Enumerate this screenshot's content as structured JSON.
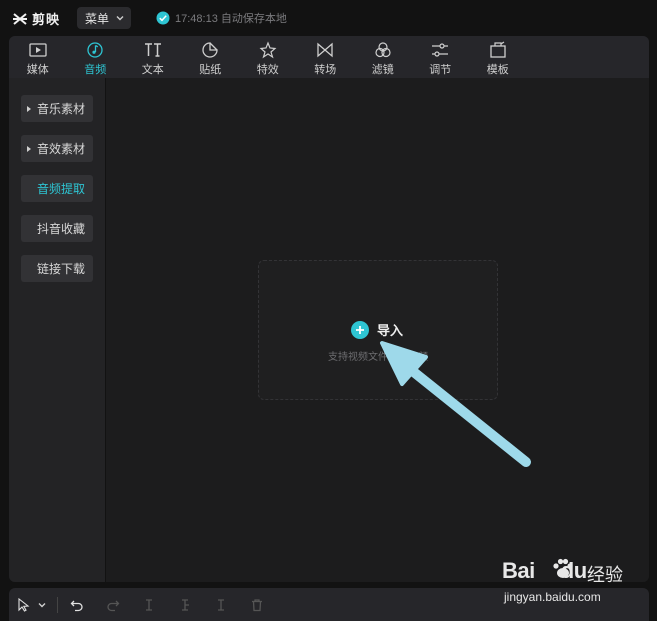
{
  "app": {
    "name": "剪映",
    "menu_label": "菜单",
    "save_status": "17:48:13 自动保存本地"
  },
  "toolbar": {
    "tabs": [
      {
        "label": "媒体",
        "icon": "play-icon"
      },
      {
        "label": "音频",
        "icon": "music-note-icon",
        "active": true
      },
      {
        "label": "文本",
        "icon": "text-icon"
      },
      {
        "label": "贴纸",
        "icon": "sticker-icon"
      },
      {
        "label": "特效",
        "icon": "effects-star-icon"
      },
      {
        "label": "转场",
        "icon": "transition-icon"
      },
      {
        "label": "滤镜",
        "icon": "filter-icon"
      },
      {
        "label": "调节",
        "icon": "adjust-sliders-icon"
      },
      {
        "label": "模板",
        "icon": "template-icon"
      }
    ]
  },
  "sidebar": {
    "items": [
      {
        "label": "音乐素材",
        "expandable": true
      },
      {
        "label": "音效素材",
        "expandable": true
      },
      {
        "label": "音频提取",
        "active": true
      },
      {
        "label": "抖音收藏"
      },
      {
        "label": "链接下载"
      }
    ]
  },
  "dropzone": {
    "import_label": "导入",
    "hint": "支持视频文件导入音频"
  },
  "bottombar": {
    "icons": [
      "select-cursor-icon",
      "undo-icon",
      "redo-icon",
      "split-icon",
      "split-left-icon",
      "split-right-icon",
      "delete-icon"
    ]
  },
  "watermark": {
    "brand": "Bai",
    "brand_suffix": "du",
    "brand_cn": "经验",
    "url": "jingyan.baidu.com"
  },
  "colors": {
    "accent": "#2ec5d3",
    "arrow": "#9ed9ea"
  }
}
